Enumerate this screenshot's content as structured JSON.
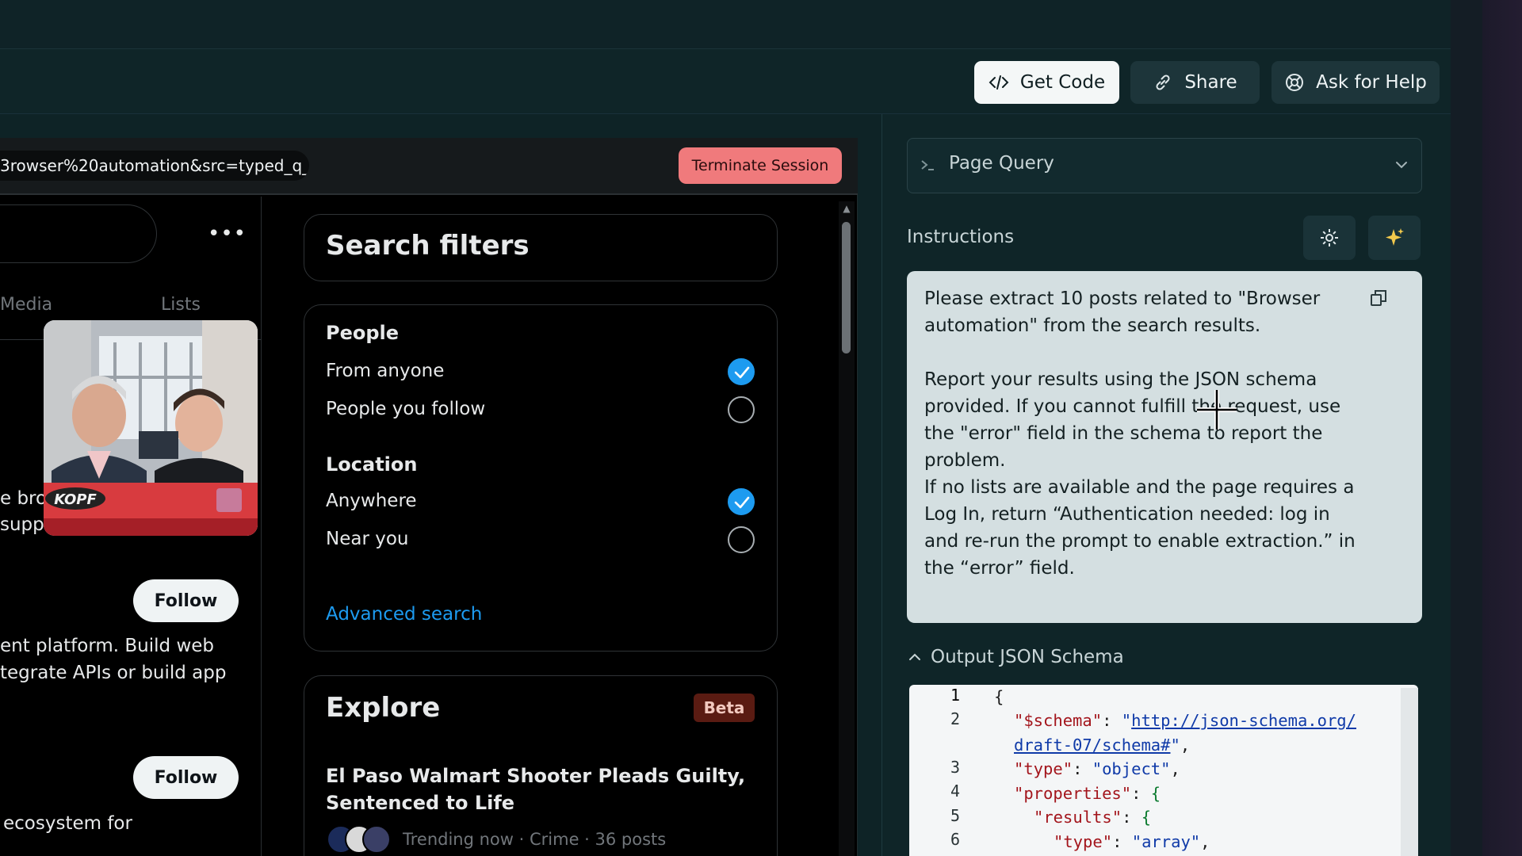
{
  "header": {
    "get_code_label": "Get Code",
    "share_label": "Share",
    "help_label": "Ask for Help"
  },
  "browser": {
    "url_fragment": "3rowser%20automation&src=typed_q_",
    "terminate_label": "Terminate Session"
  },
  "feed": {
    "tabs": [
      "Media",
      "Lists"
    ],
    "more_glyph": "•••",
    "snippets": [
      "e bro",
      "suppo",
      "ent platform. Build web",
      "tegrate APIs or build app",
      "ecosystem for"
    ],
    "follow_label": "Follow",
    "video_badge": "KOPF"
  },
  "search_filters": {
    "title": "Search filters",
    "people_heading": "People",
    "people_options": [
      {
        "label": "From anyone",
        "selected": true
      },
      {
        "label": "People you follow",
        "selected": false
      }
    ],
    "location_heading": "Location",
    "location_options": [
      {
        "label": "Anywhere",
        "selected": true
      },
      {
        "label": "Near you",
        "selected": false
      }
    ],
    "advanced_label": "Advanced search"
  },
  "explore": {
    "title": "Explore",
    "badge": "Beta",
    "trend_title": "El Paso Walmart Shooter Pleads Guilty, Sentenced to Life",
    "trend_meta": "Trending now · Crime · 36 posts"
  },
  "right_panel": {
    "query_label": "Page Query",
    "instructions_label": "Instructions",
    "instructions_text": "Please extract 10 posts related to \"Browser automation\" from the search results.\n\nReport your results using the JSON schema provided. If you cannot fulfill the request, use the \"error\" field in the schema to report the problem.\nIf no lists are available and the page requires a Log In, return “Authentication needed: log in and re-run the prompt to enable extraction.” in the “error” field.",
    "schema_label": "Output JSON Schema",
    "code_line_numbers": [
      "1",
      "2",
      "3",
      "4",
      "5",
      "6"
    ]
  },
  "colors": {
    "accent_blue": "#1d9bf0",
    "terminate_red": "#f07a7c",
    "panel_bg": "#0f2528"
  }
}
